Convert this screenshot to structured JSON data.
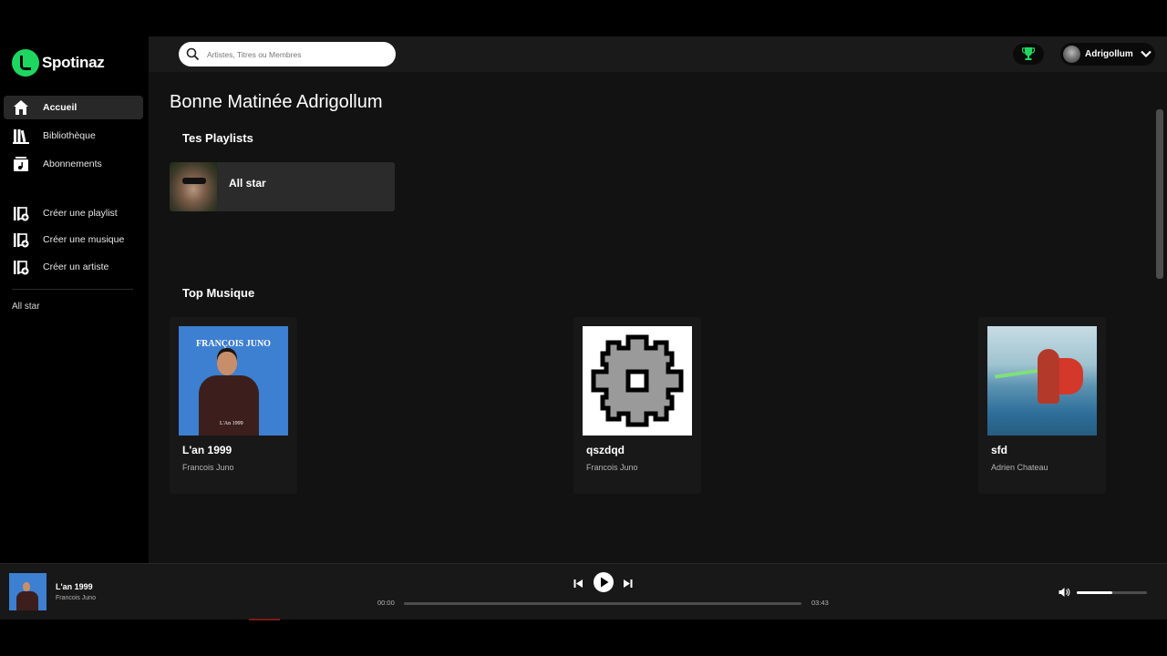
{
  "app": {
    "name": "Spotinaz",
    "brand_color": "#1ed760"
  },
  "sidebar": {
    "nav": [
      {
        "label": "Accueil",
        "icon": "home-icon",
        "active": true
      },
      {
        "label": "Bibliothèque",
        "icon": "library-icon",
        "active": false
      },
      {
        "label": "Abonnements",
        "icon": "subscriptions-icon",
        "active": false
      }
    ],
    "actions": [
      {
        "label": "Créer une playlist",
        "icon": "create-icon"
      },
      {
        "label": "Créer une musique",
        "icon": "create-icon"
      },
      {
        "label": "Créer un artiste",
        "icon": "create-icon"
      }
    ],
    "playlists": [
      "All star"
    ]
  },
  "topbar": {
    "search_placeholder": "Artistes, Titres ou Membres",
    "trophy_icon": "trophy-icon",
    "user": {
      "name": "Adrigollum"
    }
  },
  "main": {
    "greeting": "Bonne Matinée Adrigollum",
    "playlists_section": "Tes Playlists",
    "playlists": [
      {
        "title": "All star"
      }
    ],
    "top_section": "Top Musique",
    "tracks": [
      {
        "title": "L'an 1999",
        "artist": "Francois Juno",
        "cover_heading": "FRANÇOIS JUNO",
        "cover_title": "L'An 1999"
      },
      {
        "title": "qszdqd",
        "artist": "Francois Juno"
      },
      {
        "title": "sfd",
        "artist": "Adrien Chateau"
      }
    ]
  },
  "player": {
    "title": "L'an 1999",
    "artist": "Francois Juno",
    "current_time": "00:00",
    "duration": "03:43",
    "progress": 0,
    "volume": 0.5
  }
}
